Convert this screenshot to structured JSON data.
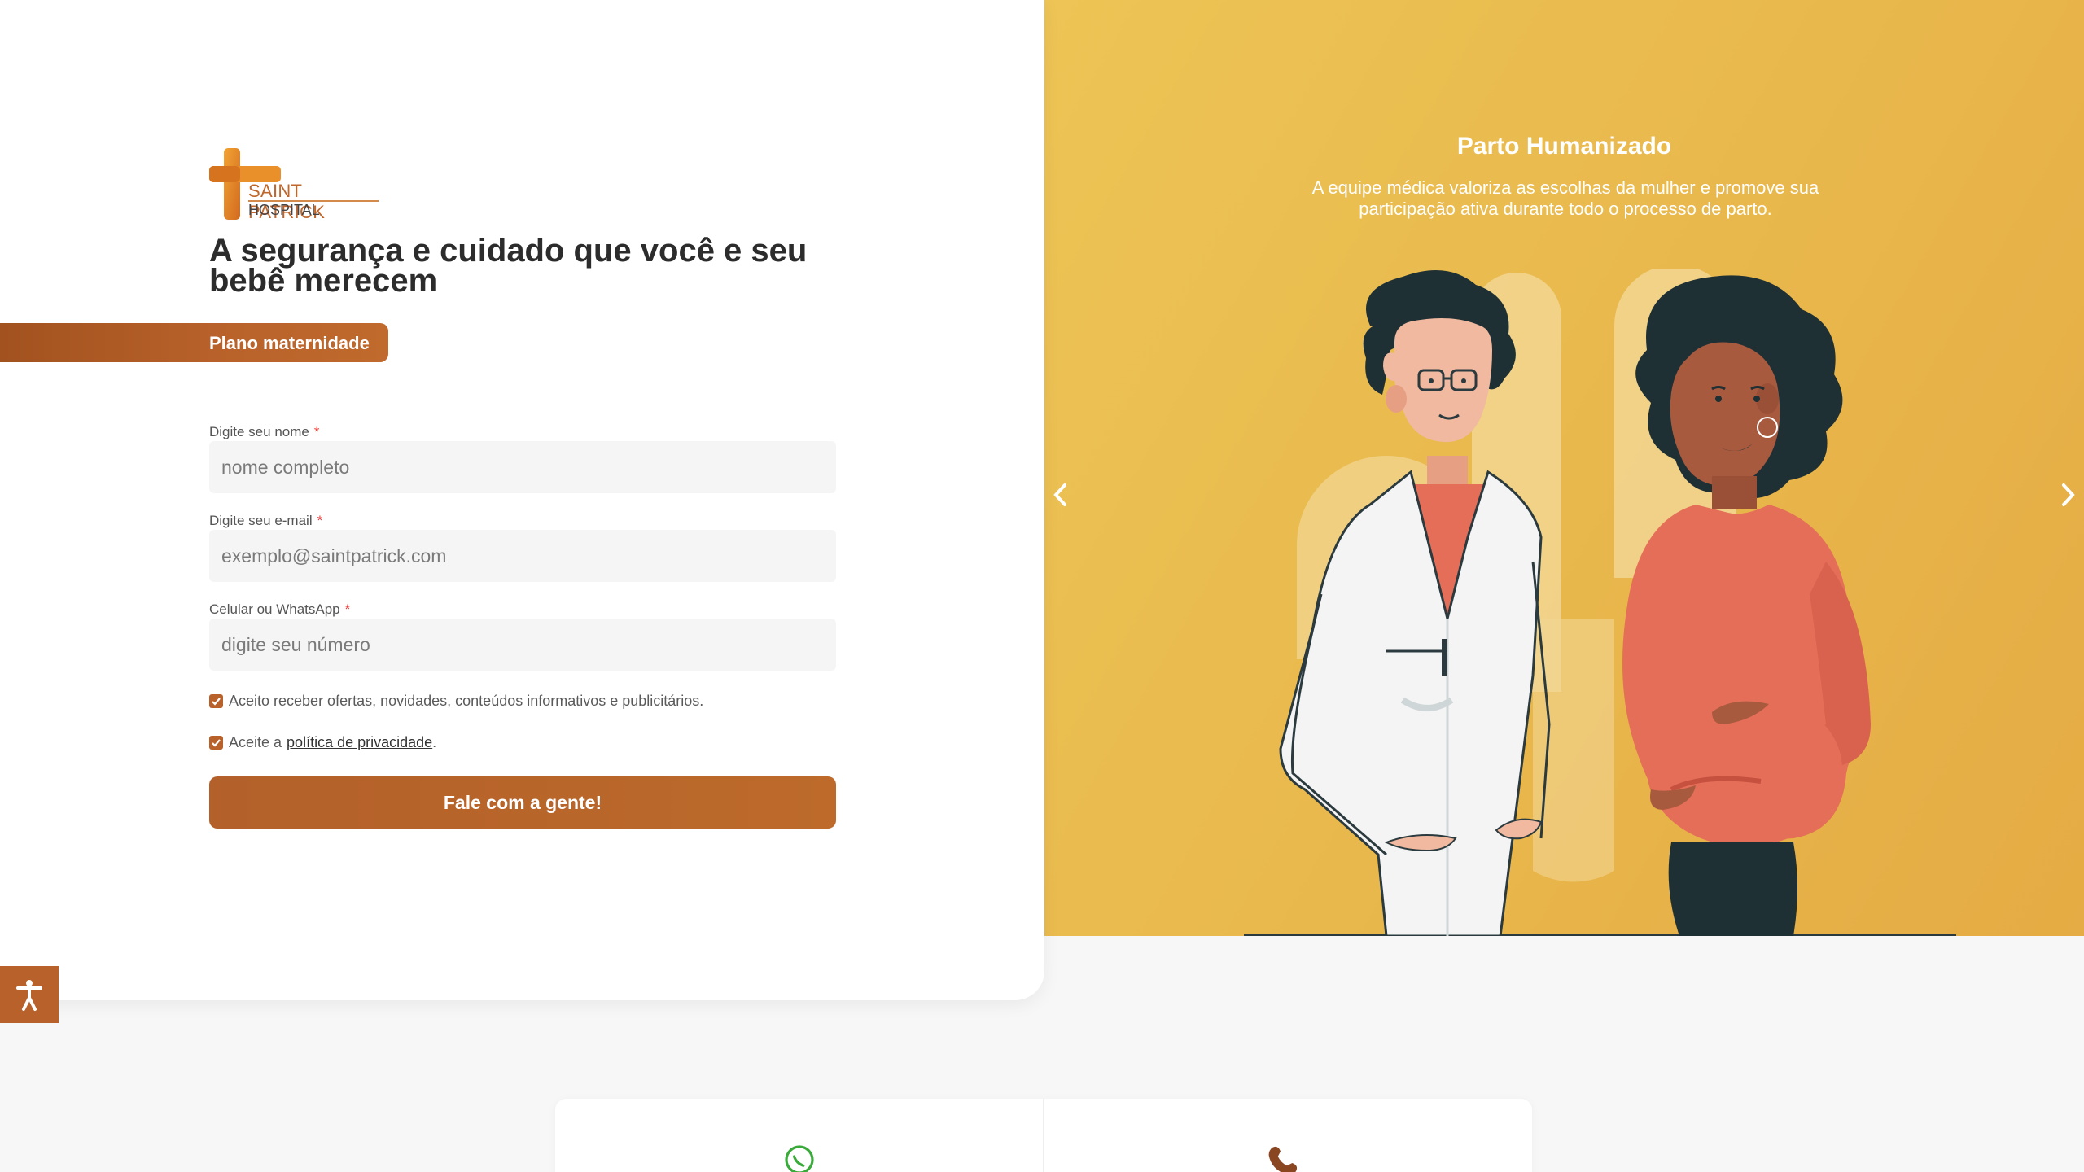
{
  "brand": {
    "logo_line1": "SAINT PATRICK",
    "logo_line2": "HOSPITAL",
    "orange": "#E98B1F",
    "brown": "#B8612A"
  },
  "hero": {
    "headline": "A segurança e cuidado que você e seu bebê merecem",
    "plan_label": "Plano maternidade"
  },
  "form": {
    "name_label": "Digite seu nome",
    "name_placeholder": "nome completo",
    "email_label": "Digite seu e-mail",
    "email_placeholder": "exemplo@saintpatrick.com",
    "phone_label": "Celular ou WhatsApp",
    "phone_placeholder": "digite seu número",
    "required_mark": "*",
    "consent_offers": "Aceito receber ofertas, novidades, conteúdos informativos e publicitários.",
    "consent_privacy_prefix": "Aceite a",
    "consent_privacy_link": "política de privacidade",
    "consent_privacy_suffix": ".",
    "submit_label": "Fale com a gente!"
  },
  "slider": {
    "title": "Parto Humanizado",
    "text": "A equipe médica valoriza as escolhas da mulher e promove sua participação ativa durante todo o processo de parto.",
    "prev_icon": "chevron-left-icon",
    "next_icon": "chevron-right-icon"
  },
  "contact": {
    "icons": [
      "whatsapp-icon",
      "phone-icon"
    ]
  },
  "accessibility": {
    "icon": "accessibility-icon"
  }
}
